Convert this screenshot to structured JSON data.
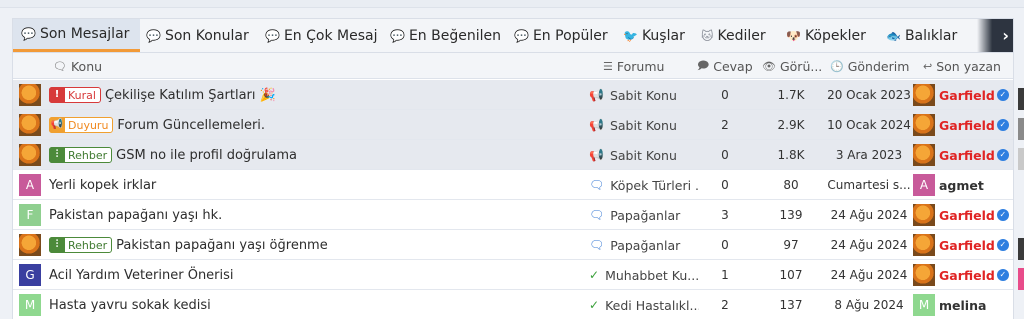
{
  "tabs": [
    {
      "label": "Son Mesajlar",
      "icon": "chat-bubble-icon",
      "active": true
    },
    {
      "label": "Son Konular",
      "icon": "chat-bubble-icon"
    },
    {
      "label": "En Çok Mesaj",
      "icon": "chat-bubble-icon"
    },
    {
      "label": "En Beğenilen",
      "icon": "chat-bubble-icon"
    },
    {
      "label": "En Popüler",
      "icon": "chat-bubble-icon"
    },
    {
      "label": "Kuşlar",
      "icon": "bird-icon"
    },
    {
      "label": "Kediler",
      "icon": "cat-icon"
    },
    {
      "label": "Köpekler",
      "icon": "dog-icon"
    },
    {
      "label": "Balıklar",
      "icon": "fish-icon"
    }
  ],
  "columns": {
    "konu": "Konu",
    "forumu": "Forumu",
    "cevap": "Cevap",
    "goruntuleme": "Görü...",
    "gonderim": "Gönderim",
    "son_yazan": "Son yazan"
  },
  "rows": [
    {
      "sticky": true,
      "badge": "Kural",
      "badge_color": "red",
      "badge_icon": "exclamation-icon",
      "title": "Çekilişe Katılım Şartları 🎉",
      "forum": "Sabit Konu",
      "forum_icon": "megaphone-icon",
      "replies": "0",
      "views": "1.7K",
      "date": "20 Ocak 2023",
      "author": "Garfield",
      "author_avatar": "garfield",
      "last": "Garfield",
      "last_avatar": "garfield",
      "last_color": "red",
      "verified": true
    },
    {
      "sticky": true,
      "badge": "Duyuru",
      "badge_color": "orange",
      "badge_icon": "megaphone-icon",
      "title": "Forum Güncellemeleri.",
      "forum": "Sabit Konu",
      "forum_icon": "megaphone-icon",
      "replies": "2",
      "views": "2.9K",
      "date": "10 Ocak 2024",
      "author": "Garfield",
      "author_avatar": "garfield",
      "last": "Garfield",
      "last_avatar": "garfield",
      "last_color": "red",
      "verified": true
    },
    {
      "sticky": true,
      "badge": "Rehber",
      "badge_color": "green",
      "badge_icon": "sliders-icon",
      "title": "GSM no ile profil doğrulama",
      "forum": "Sabit Konu",
      "forum_icon": "megaphone-icon",
      "replies": "0",
      "views": "1.8K",
      "date": "3 Ara 2023",
      "author": "Garfield",
      "author_avatar": "garfield",
      "last": "Garfield",
      "last_avatar": "garfield",
      "last_color": "red",
      "verified": true
    },
    {
      "sticky": false,
      "badge": "",
      "title": "Yerli kopek irklar",
      "forum": "Köpek Türleri ...",
      "forum_icon": "chat-bubbles-icon",
      "replies": "0",
      "views": "80",
      "date": "Cumartesi s...",
      "author_letter": "A",
      "author_color": "#c85a9a",
      "last": "agmet",
      "last_letter": "A",
      "last_avatar_color": "#c85a9a",
      "last_color": "dark",
      "verified": false
    },
    {
      "sticky": false,
      "badge": "",
      "title": "Pakistan papağanı yaşı hk.",
      "forum": "Papağanlar",
      "forum_icon": "chat-bubbles-icon",
      "replies": "3",
      "views": "139",
      "date": "24 Ağu 2024",
      "author_letter": "F",
      "author_color": "#8fcf8f",
      "last": "Garfield",
      "last_avatar": "garfield",
      "last_color": "red",
      "verified": true
    },
    {
      "sticky": false,
      "badge": "Rehber",
      "badge_color": "green",
      "badge_icon": "sliders-icon",
      "title": "Pakistan papağanı yaşı öğrenme",
      "forum": "Papağanlar",
      "forum_icon": "chat-bubbles-icon",
      "replies": "0",
      "views": "97",
      "date": "24 Ağu 2024",
      "author": "Garfield",
      "author_avatar": "garfield",
      "last": "Garfield",
      "last_avatar": "garfield",
      "last_color": "red",
      "verified": true
    },
    {
      "sticky": false,
      "badge": "",
      "title": "Acil Yardım Veteriner Önerisi",
      "forum": "Muhabbet Ku...",
      "forum_icon": "check-circle-icon",
      "replies": "1",
      "views": "107",
      "date": "24 Ağu 2024",
      "author_letter": "G",
      "author_color": "#3a3fa0",
      "last": "Garfield",
      "last_avatar": "garfield",
      "last_color": "red",
      "verified": true
    },
    {
      "sticky": false,
      "badge": "",
      "title": "Hasta yavru sokak kedisi",
      "forum": "Kedi Hastalıkl...",
      "forum_icon": "check-circle-icon",
      "replies": "2",
      "views": "137",
      "date": "8 Ağu 2024",
      "author_letter": "M",
      "author_color": "#8fd88f",
      "last": "melina",
      "last_letter": "M",
      "last_avatar_color": "#8fd88f",
      "last_color": "dark",
      "verified": false
    }
  ]
}
